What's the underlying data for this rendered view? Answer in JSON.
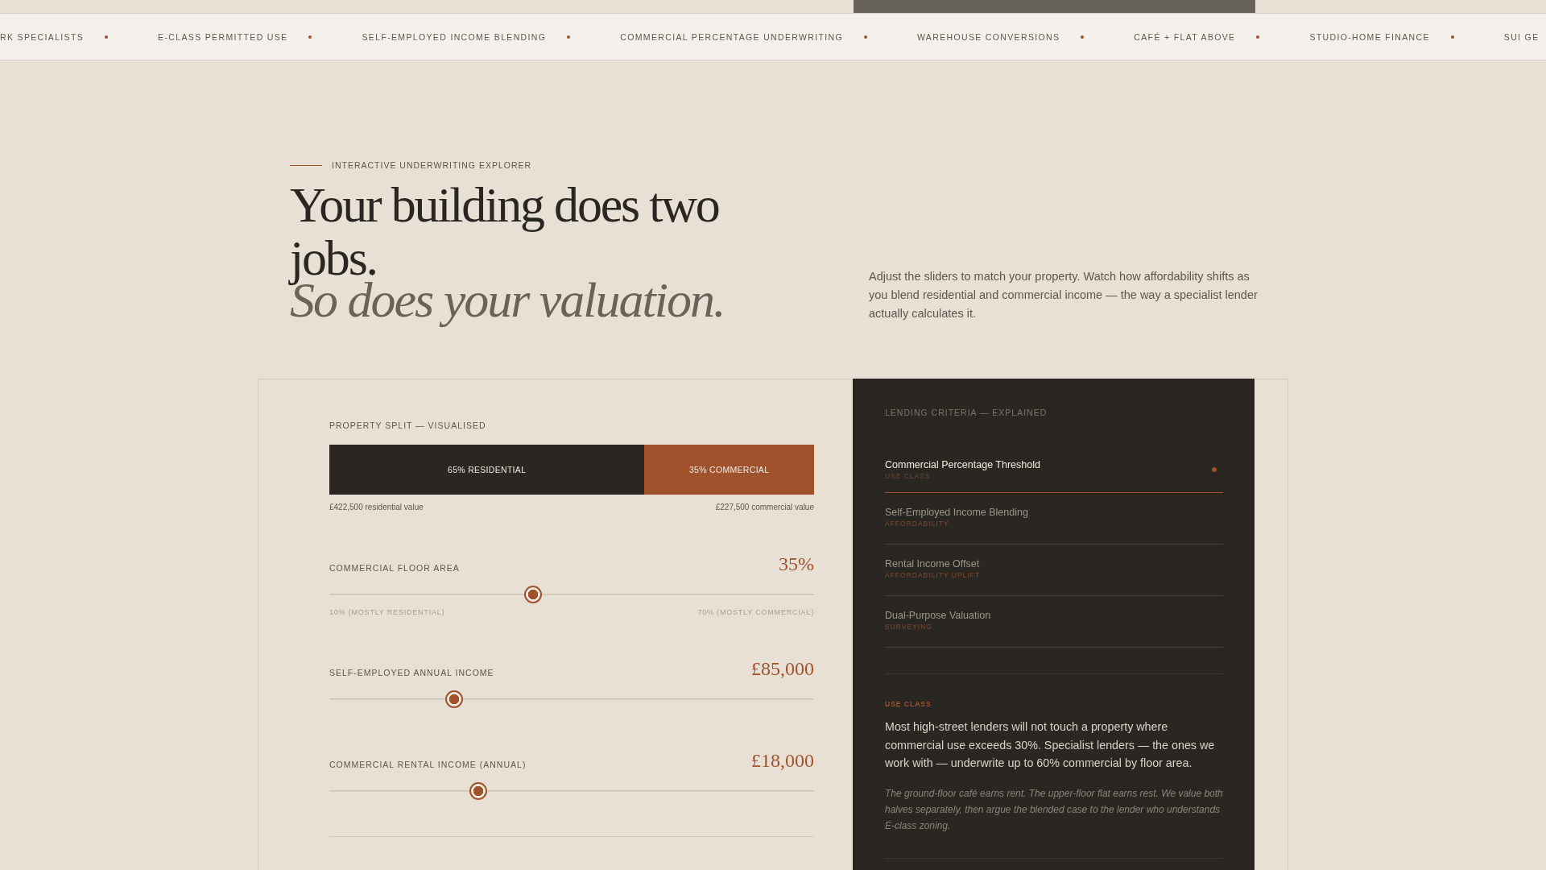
{
  "ticker": [
    {
      "label": "RK SPECIALISTS"
    },
    {
      "label": "E-CLASS PERMITTED USE"
    },
    {
      "label": "SELF-EMPLOYED INCOME BLENDING"
    },
    {
      "label": "COMMERCIAL PERCENTAGE UNDERWRITING"
    },
    {
      "label": "WAREHOUSE CONVERSIONS"
    },
    {
      "label": "CAFÉ + FLAT ABOVE"
    },
    {
      "label": "STUDIO-HOME FINANCE"
    },
    {
      "label": "SUI GE"
    }
  ],
  "hero": {
    "eyebrow": "INTERACTIVE UNDERWRITING EXPLORER",
    "title": "Your building does two jobs.",
    "title_italic": "So does your valuation.",
    "intro": "Adjust the sliders to match your property. Watch how affordability shifts as you blend residential and commercial income — the way a specialist lender actually calculates it."
  },
  "split": {
    "label": "PROPERTY SPLIT — VISUALISED",
    "level": 0.65,
    "segments": [
      {
        "kind": "residential",
        "label": "65% RESIDENTIAL"
      },
      {
        "kind": "commercial",
        "label": "35% COMMERCIAL"
      }
    ],
    "values": [
      "£422,500 residential value",
      "£227,500 commercial value"
    ]
  },
  "sliders": [
    {
      "label": "COMMERCIAL FLOOR AREA",
      "value": "35%",
      "level": 0.42,
      "min_label": "10% (MOSTLY RESIDENTIAL)",
      "max_label": "70% (MOSTLY COMMERCIAL)"
    },
    {
      "label": "SELF-EMPLOYED ANNUAL INCOME",
      "value": "£85,000",
      "level": 0.257
    },
    {
      "label": "COMMERCIAL RENTAL INCOME (ANNUAL)",
      "value": "£18,000",
      "level": 0.307
    }
  ],
  "criteria": {
    "label": "LENDING CRITERIA — EXPLAINED",
    "items": [
      {
        "title": "Commercial Percentage Threshold",
        "category": "USE CLASS",
        "selected": true
      },
      {
        "title": "Self-Employed Income Blending",
        "category": "AFFORDABILITY",
        "selected": false
      },
      {
        "title": "Rental Income Offset",
        "category": "AFFORDABILITY UPLIFT",
        "selected": false
      },
      {
        "title": "Dual-Purpose Valuation",
        "category": "SURVEYING",
        "selected": false
      }
    ],
    "detail": {
      "category": "USE CLASS",
      "body": "Most high-street lenders will not touch a property where commercial use exceeds 30%. Specialist lenders — the ones we work with — underwrite up to 60% commercial by floor area.",
      "note": "The ground-floor café earns rent. The upper-floor flat earns rest. We value both halves separately, then argue the blended case to the lender who understands E-class zoning."
    }
  }
}
